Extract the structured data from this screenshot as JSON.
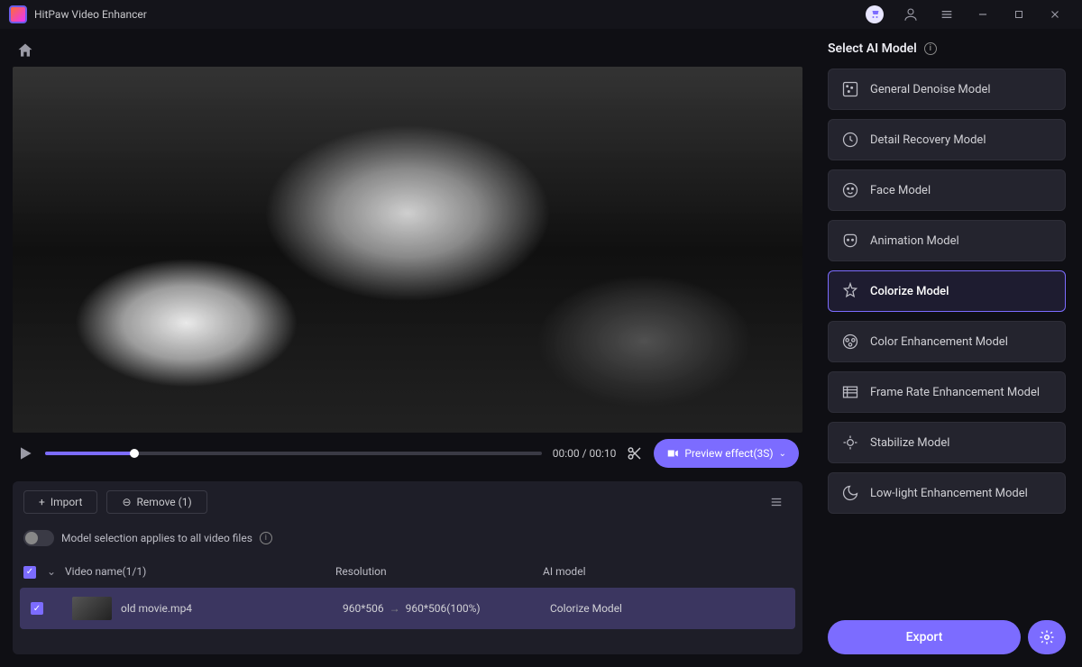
{
  "app": {
    "title": "HitPaw Video Enhancer"
  },
  "player": {
    "current_time": "00:00",
    "duration": "00:10",
    "time_display": "00:00 / 00:10",
    "preview_label": "Preview effect(3S)"
  },
  "file_panel": {
    "import_label": "Import",
    "remove_label": "Remove (1)",
    "toggle_label": "Model selection applies to all video files",
    "header": {
      "name": "Video name(1/1)",
      "resolution": "Resolution",
      "ai_model": "AI model"
    },
    "files": [
      {
        "name": "old movie.mp4",
        "res_in": "960*506",
        "res_out": "960*506(100%)",
        "model": "Colorize Model"
      }
    ]
  },
  "sidebar": {
    "title": "Select AI Model",
    "models": [
      {
        "label": "General Denoise Model"
      },
      {
        "label": "Detail Recovery Model"
      },
      {
        "label": "Face Model"
      },
      {
        "label": "Animation Model"
      },
      {
        "label": "Colorize Model"
      },
      {
        "label": "Color Enhancement Model"
      },
      {
        "label": "Frame Rate Enhancement Model"
      },
      {
        "label": "Stabilize Model"
      },
      {
        "label": "Low-light Enhancement Model"
      }
    ],
    "selected_index": 4,
    "export_label": "Export"
  }
}
